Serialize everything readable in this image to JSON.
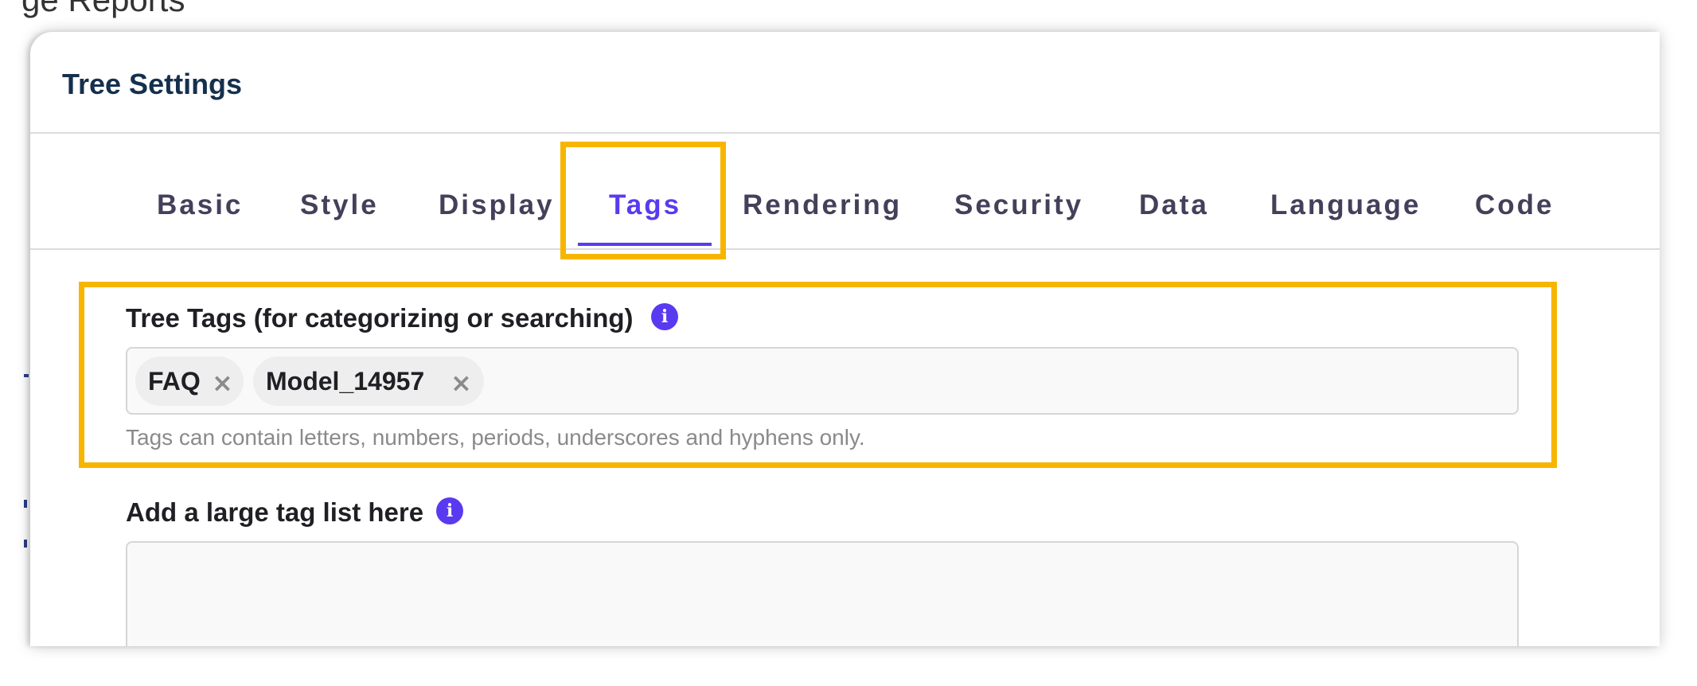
{
  "background": {
    "partial_text": "ge Reports"
  },
  "modal": {
    "title": "Tree Settings"
  },
  "tabs": [
    {
      "label": "Basic",
      "active": false
    },
    {
      "label": "Style",
      "active": false
    },
    {
      "label": "Display",
      "active": false
    },
    {
      "label": "Tags",
      "active": true
    },
    {
      "label": "Rendering",
      "active": false
    },
    {
      "label": "Security",
      "active": false
    },
    {
      "label": "Data",
      "active": false
    },
    {
      "label": "Language",
      "active": false
    },
    {
      "label": "Code",
      "active": false
    }
  ],
  "tags_field": {
    "label": "Tree Tags (for categorizing or searching)",
    "info_icon": "info-icon",
    "tags": [
      {
        "label": "FAQ",
        "remove": "×"
      },
      {
        "label": "Model_14957",
        "remove": "×"
      }
    ],
    "helper": "Tags can contain letters, numbers, periods, underscores and hyphens only."
  },
  "large_tag_list": {
    "label": "Add a large tag list here",
    "info_icon": "info-icon",
    "value": ""
  },
  "colors": {
    "accent": "#5a3af0",
    "highlight": "#f7b500",
    "title": "#15304d",
    "tab_text": "#44405a"
  }
}
